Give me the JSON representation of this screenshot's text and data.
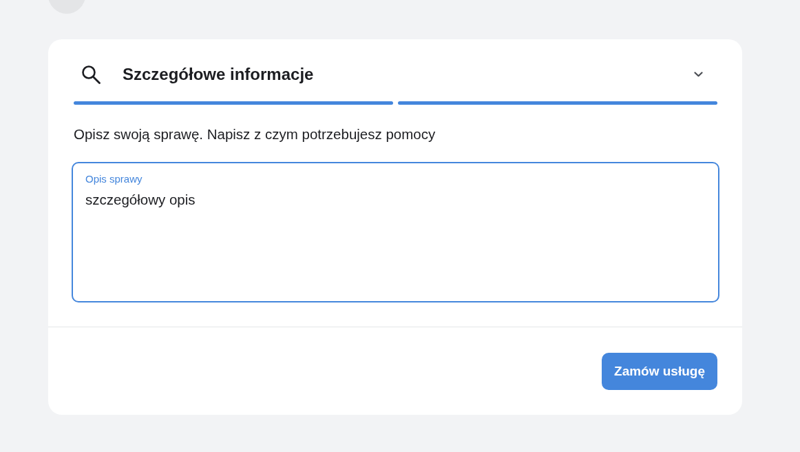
{
  "section": {
    "title": "Szczegółowe informacje"
  },
  "steps": [
    {
      "completed": true
    },
    {
      "completed": true
    }
  ],
  "prompt": "Opisz swoją sprawę. Napisz z czym potrzebujesz pomocy",
  "description_field": {
    "label": "Opis sprawy",
    "value": "szczegółowy opis",
    "focused": true
  },
  "submit_button": {
    "label": "Zamów usługę"
  }
}
